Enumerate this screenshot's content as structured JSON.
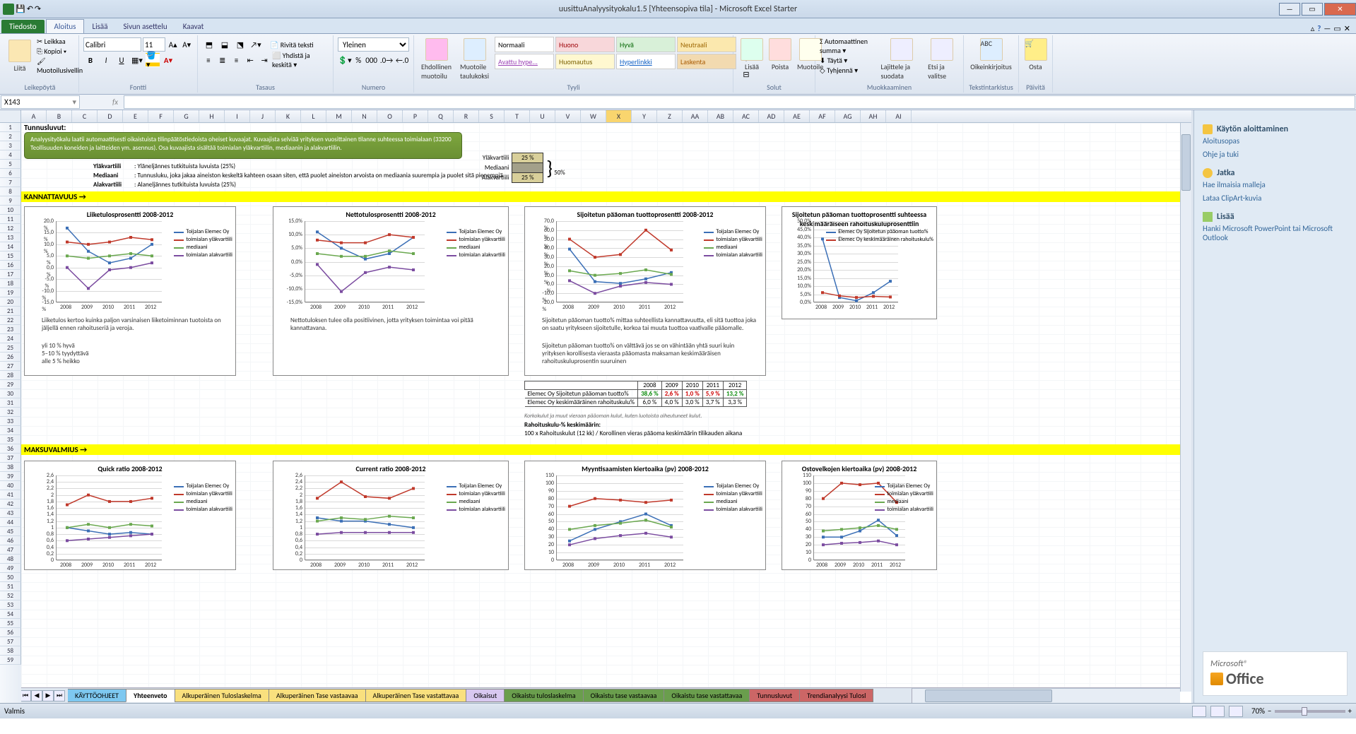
{
  "window": {
    "title": "uusittuAnalyysityokalu1.5 [Yhteensopiva tila] - Microsoft Excel Starter"
  },
  "tabs": {
    "file": "Tiedosto",
    "items": [
      "Aloitus",
      "Lisää",
      "Sivun asettelu",
      "Kaavat"
    ],
    "active": 0
  },
  "ribbon": {
    "clipboard": {
      "paste": "Liitä",
      "cut": "Leikkaa",
      "copy": "Kopioi",
      "format_painter": "Muotoilusivellin",
      "group": "Leikepöytä"
    },
    "font": {
      "family": "Calibri",
      "size": "11",
      "group": "Fontti"
    },
    "alignment": {
      "wrap": "Rivitä teksti",
      "merge": "Yhdistä ja keskitä",
      "group": "Tasaus"
    },
    "number": {
      "format": "Yleinen",
      "group": "Numero"
    },
    "styles": {
      "cond": "Ehdollinen muotoilu",
      "as_table": "Muotoile taulukoksi",
      "group": "Tyyli",
      "gallery": [
        {
          "label": "Normaali",
          "bg": "#ffffff",
          "fg": "#000"
        },
        {
          "label": "Huono",
          "bg": "#f8d7da",
          "fg": "#9c0006"
        },
        {
          "label": "Hyvä",
          "bg": "#d8f0d8",
          "fg": "#006400"
        },
        {
          "label": "Neutraali",
          "bg": "#fbe8ae",
          "fg": "#9c6500"
        },
        {
          "label": "Avattu hype...",
          "bg": "#ffffff",
          "fg": "#9b43b6"
        },
        {
          "label": "Huomautus",
          "bg": "#fff8d0",
          "fg": "#7a6000"
        },
        {
          "label": "Hyperlinkki",
          "bg": "#ffffff",
          "fg": "#1463c6"
        },
        {
          "label": "Laskenta",
          "bg": "#f2dab0",
          "fg": "#a95a00"
        }
      ]
    },
    "cells": {
      "insert": "Lisää",
      "delete": "Poista",
      "format": "Muotoile",
      "group": "Solut"
    },
    "editing": {
      "autosum": "Automaattinen summa",
      "fill": "Täytä",
      "clear": "Tyhjennä",
      "sort": "Lajittele ja suodata",
      "find": "Etsi ja valitse",
      "group": "Muokkaaminen"
    },
    "proofing": {
      "spell": "Oikeinkirjoitus",
      "group": "Tekstintarkistus"
    },
    "update": {
      "label": "Osta",
      "group": "Päivitä"
    }
  },
  "formula_bar": {
    "name_box": "X143",
    "formula": ""
  },
  "columns": [
    "A",
    "B",
    "C",
    "D",
    "E",
    "F",
    "G",
    "H",
    "I",
    "J",
    "K",
    "L",
    "M",
    "N",
    "O",
    "P",
    "Q",
    "R",
    "S",
    "T",
    "U",
    "V",
    "W",
    "X",
    "Y",
    "Z",
    "AA",
    "AB",
    "AC",
    "AD",
    "AE",
    "AF",
    "AG",
    "AH",
    "AI"
  ],
  "selected_col": "X",
  "task_pane": {
    "start_head": "Käytön aloittaminen",
    "start_links": [
      "Aloitusopas",
      "Ohje ja tuki"
    ],
    "continue_head": "Jatka",
    "continue_links": [
      "Hae ilmaisia malleja",
      "Lataa ClipArt-kuvia"
    ],
    "more_head": "Lisää",
    "more_links": [
      "Hanki Microsoft PowerPoint tai Microsoft Outlook"
    ],
    "brand_top": "Microsoft®",
    "brand_main": "Office"
  },
  "sheet": {
    "header": "Tunnusluvut:",
    "green_note": "Analyysityökalu laatii automaattisesti oikaistuista tilinpäätöstiedoista oheiset kuvaajat. Kuvaajista selviää yrityksen vuosittainen tilanne suhteessa toimialaan (33200 Teollisuuden koneiden ja laitteiden ym. asennus). Osa kuvaajista sisältää toimialan yläkvartiilin, mediaanin ja alakvartiilin.",
    "defs": [
      {
        "term": "Yläkvartiili",
        "text": ": Yläneljännes tutkituista luvuista (25%)"
      },
      {
        "term": "Mediaani",
        "text": ": Tunnusluku, joka jakaa aineiston keskeltä kahteen osaan siten, että puolet aineiston arvoista on mediaania suurempia ja puolet sitä pienempiä"
      },
      {
        "term": "Alakvartiili",
        "text": ": Alaneljännes tutkituista luvuista (25%)"
      }
    ],
    "quartiles": {
      "upper": "Yläkvartiili",
      "upper_v": "25 %",
      "median": "Mediaani",
      "lower": "Alakvartiili",
      "lower_v": "25 %",
      "total": "50%"
    },
    "band1": "KANNATTAVUUS",
    "band2": "MAKSUVALMIUS"
  },
  "legend_std": [
    "Toijalan Elemec Oy",
    "toimialan yläkvartiili",
    "mediaani",
    "toimialan alakvartiili"
  ],
  "legend_ch4": [
    "Elemec Oy Sijoitetun pääoman tuotto%",
    "Elemec Oy keskimääräinen rahoituskulu%"
  ],
  "years": [
    "2008",
    "2009",
    "2010",
    "2011",
    "2012"
  ],
  "chart_data": [
    {
      "id": "ch1",
      "type": "line",
      "title": "Liiketulosprosentti 2008-2012",
      "x": [
        "2008",
        "2009",
        "2010",
        "2011",
        "2012"
      ],
      "ylim": [
        -15,
        20
      ],
      "yticks": [
        -15,
        -10,
        -5,
        0,
        5,
        10,
        15,
        20
      ],
      "yfmt": "{v},0 %",
      "series": [
        {
          "name": "Toijalan Elemec Oy",
          "color": "#3b6fb6",
          "values": [
            17,
            7,
            2,
            4,
            10
          ]
        },
        {
          "name": "toimialan yläkvartiili",
          "color": "#c0392b",
          "values": [
            11,
            10,
            11,
            13,
            12
          ]
        },
        {
          "name": "mediaani",
          "color": "#6aa84f",
          "values": [
            5,
            4,
            5,
            6,
            5
          ]
        },
        {
          "name": "toimialan alakvartiili",
          "color": "#7b4ca0",
          "values": [
            0,
            -9,
            -1,
            0,
            2
          ]
        }
      ],
      "desc": "Liiketulos kertoo kuinka paljon varsinaisen liiketoiminnan tuotoista on jäljellä ennen rahoituseriä ja veroja.",
      "desc2": "yli 10 % hyvä\n5–10 % tyydyttävä\nalle 5 % heikko"
    },
    {
      "id": "ch2",
      "type": "line",
      "title": "Nettotulosprosentti 2008-2012",
      "x": [
        "2008",
        "2009",
        "2010",
        "2011",
        "2012"
      ],
      "ylim": [
        -15,
        15
      ],
      "yticks": [
        -15,
        -10,
        -5,
        0,
        5,
        10,
        15
      ],
      "yfmt": "{v},0%",
      "series": [
        {
          "name": "Toijalan Elemec Oy",
          "color": "#3b6fb6",
          "values": [
            11,
            5,
            1,
            3,
            9
          ]
        },
        {
          "name": "toimialan yläkvartiili",
          "color": "#c0392b",
          "values": [
            8,
            7,
            7,
            10,
            9
          ]
        },
        {
          "name": "mediaani",
          "color": "#6aa84f",
          "values": [
            3,
            2,
            2,
            4,
            3
          ]
        },
        {
          "name": "toimialan alakvartiili",
          "color": "#7b4ca0",
          "values": [
            -1,
            -11,
            -4,
            -2,
            -3
          ]
        }
      ],
      "desc": "Nettotuloksen tulee olla positiivinen, jotta yrityksen toimintaa voi pitää kannattavana."
    },
    {
      "id": "ch3",
      "type": "line",
      "title": "Sijoitetun pääoman tuottoprosentti 2008-2012",
      "x": [
        "2008",
        "2009",
        "2010",
        "2011",
        "2012"
      ],
      "ylim": [
        -20,
        70
      ],
      "yticks": [
        -20,
        -10,
        0,
        10,
        20,
        30,
        40,
        50,
        60,
        70
      ],
      "yfmt": "{v},0 %",
      "series": [
        {
          "name": "Toijalan Elemec Oy",
          "color": "#3b6fb6",
          "values": [
            39,
            3,
            1,
            6,
            13
          ]
        },
        {
          "name": "toimialan yläkvartiili",
          "color": "#c0392b",
          "values": [
            50,
            30,
            33,
            60,
            38
          ]
        },
        {
          "name": "mediaani",
          "color": "#6aa84f",
          "values": [
            15,
            10,
            12,
            16,
            11
          ]
        },
        {
          "name": "toimialan alakvartiili",
          "color": "#7b4ca0",
          "values": [
            4,
            -10,
            -2,
            2,
            0
          ]
        }
      ],
      "desc": "Sijoitetun pääoman tuotto% mittaa suhteellista kannattavuutta, eli sitä tuottoa joka on saatu yritykseen sijoitetulle, korkoa tai muuta tuottoa vaativalle pääomalle.",
      "desc2": "Sijoitetun pääoman tuotto% on välttävä jos se on vähintään yhtä suuri kuin yrityksen korollisesta vieraasta pääomasta maksaman keskimääräisen rahoituskuluprosentin suuruinen"
    },
    {
      "id": "ch4",
      "type": "line",
      "title": "Sijoitetun pääoman tuottoprosentti suhteessa keskimääräiseen rahoituskuluprosenttiin",
      "x": [
        "2008",
        "2009",
        "2010",
        "2011",
        "2012"
      ],
      "ylim": [
        0,
        50
      ],
      "yticks": [
        0,
        5,
        10,
        15,
        20,
        25,
        30,
        35,
        40,
        45,
        50
      ],
      "yfmt": "{v},0%",
      "series": [
        {
          "name": "Elemec Oy Sijoitetun pääoman tuotto%",
          "color": "#3b6fb6",
          "values": [
            39,
            3,
            1,
            6,
            13
          ]
        },
        {
          "name": "Elemec Oy keskimääräinen rahoituskulu%",
          "color": "#c0392b",
          "values": [
            6,
            4,
            3,
            3.7,
            3.3
          ]
        }
      ]
    },
    {
      "id": "ch5",
      "type": "line",
      "title": "Quick ratio 2008-2012",
      "x": [
        "2008",
        "2009",
        "2010",
        "2011",
        "2012"
      ],
      "ylim": [
        0,
        2.6
      ],
      "yticks": [
        0,
        0.2,
        0.4,
        0.6,
        0.8,
        1.0,
        1.2,
        1.4,
        1.6,
        1.8,
        2.0,
        2.2,
        2.4,
        2.6
      ],
      "yfmt": "{v}",
      "series": [
        {
          "name": "Toijalan Elemec Oy",
          "color": "#3b6fb6",
          "values": [
            1.0,
            0.9,
            0.8,
            0.85,
            0.8
          ]
        },
        {
          "name": "toimialan yläkvartiili",
          "color": "#c0392b",
          "values": [
            1.7,
            2.0,
            1.8,
            1.8,
            1.9
          ]
        },
        {
          "name": "mediaani",
          "color": "#6aa84f",
          "values": [
            1.0,
            1.1,
            1.0,
            1.1,
            1.05
          ]
        },
        {
          "name": "toimialan alakvartiili",
          "color": "#7b4ca0",
          "values": [
            0.6,
            0.65,
            0.7,
            0.75,
            0.8
          ]
        }
      ]
    },
    {
      "id": "ch6",
      "type": "line",
      "title": "Current ratio 2008-2012",
      "x": [
        "2008",
        "2009",
        "2010",
        "2011",
        "2012"
      ],
      "ylim": [
        0,
        2.6
      ],
      "yticks": [
        0,
        0.2,
        0.4,
        0.6,
        0.8,
        1.0,
        1.2,
        1.4,
        1.6,
        1.8,
        2.0,
        2.2,
        2.4,
        2.6
      ],
      "yfmt": "{v}",
      "series": [
        {
          "name": "Toijalan Elemec Oy",
          "color": "#3b6fb6",
          "values": [
            1.3,
            1.2,
            1.2,
            1.1,
            1.0
          ]
        },
        {
          "name": "toimialan yläkvartiili",
          "color": "#c0392b",
          "values": [
            1.9,
            2.4,
            1.95,
            1.9,
            2.2
          ]
        },
        {
          "name": "mediaani",
          "color": "#6aa84f",
          "values": [
            1.2,
            1.3,
            1.25,
            1.35,
            1.3
          ]
        },
        {
          "name": "toimialan alakvartiili",
          "color": "#7b4ca0",
          "values": [
            0.8,
            0.85,
            0.85,
            0.85,
            0.85
          ]
        }
      ]
    },
    {
      "id": "ch7",
      "type": "line",
      "title": "Myyntisaamisten kiertoaika (pv) 2008-2012",
      "x": [
        "2008",
        "2009",
        "2010",
        "2011",
        "2012"
      ],
      "ylim": [
        0,
        110
      ],
      "yticks": [
        0,
        10,
        20,
        30,
        40,
        50,
        60,
        70,
        80,
        90,
        100,
        110
      ],
      "yfmt": "{v}",
      "series": [
        {
          "name": "Toijalan Elemec Oy",
          "color": "#3b6fb6",
          "values": [
            25,
            40,
            50,
            60,
            45
          ]
        },
        {
          "name": "toimialan yläkvartiili",
          "color": "#c0392b",
          "values": [
            70,
            80,
            78,
            75,
            78
          ]
        },
        {
          "name": "mediaani",
          "color": "#6aa84f",
          "values": [
            40,
            45,
            48,
            52,
            43
          ]
        },
        {
          "name": "toimialan alakvartiili",
          "color": "#7b4ca0",
          "values": [
            20,
            28,
            32,
            35,
            30
          ]
        }
      ]
    },
    {
      "id": "ch8",
      "type": "line",
      "title": "Ostovelkojen kiertoaika (pv) 2008-2012",
      "x": [
        "2008",
        "2009",
        "2010",
        "2011",
        "2012"
      ],
      "ylim": [
        0,
        110
      ],
      "yticks": [
        0,
        10,
        20,
        30,
        40,
        50,
        60,
        70,
        80,
        90,
        100,
        110
      ],
      "yfmt": "{v}",
      "series": [
        {
          "name": "Toijalan Elemec Oy",
          "color": "#3b6fb6",
          "values": [
            30,
            30,
            38,
            52,
            32
          ]
        },
        {
          "name": "toimialan yläkvartiili",
          "color": "#c0392b",
          "values": [
            80,
            100,
            98,
            100,
            75
          ]
        },
        {
          "name": "mediaani",
          "color": "#6aa84f",
          "values": [
            38,
            40,
            42,
            45,
            40
          ]
        },
        {
          "name": "toimialan alakvartiili",
          "color": "#7b4ca0",
          "values": [
            20,
            22,
            23,
            25,
            20
          ]
        }
      ]
    }
  ],
  "table_ch3": {
    "headers": [
      "",
      "2008",
      "2009",
      "2010",
      "2011",
      "2012"
    ],
    "rows": [
      {
        "label": "Elemec Oy Sijoitetun pääoman tuotto%",
        "values": [
          "38,6 %",
          "2,6 %",
          "1,0 %",
          "5,9 %",
          "13,2 %"
        ],
        "colors": [
          "green",
          "red",
          "red",
          "red",
          "green"
        ]
      },
      {
        "label": "Elemec Oy keskimääräinen rahoituskulu%",
        "values": [
          "6,0 %",
          "4,0 %",
          "3,0 %",
          "3,7 %",
          "3,3 %"
        ],
        "colors": [
          "",
          "",
          "",
          "",
          ""
        ]
      }
    ],
    "footnote": "Korkokulut ja muut vieraan pääoman kulut, kuten luotoista aiheutuneet kulut.",
    "rk_head": "Rahoituskulu-% keskimäärin:",
    "rk_formula": "100 x Rahoituskulut (12 kk) / Korollinen vieras pääoma keskimäärin tilikauden aikana"
  },
  "sheet_tabs": [
    {
      "label": "KÄYTTÖOHJEET",
      "color": "#7ec8f0"
    },
    {
      "label": "Yhteenveto",
      "color": "#ffffff",
      "active": true
    },
    {
      "label": "Alkuperäinen Tuloslaskelma",
      "color": "#f9e07e"
    },
    {
      "label": "Alkuperäinen Tase vastaavaa",
      "color": "#f9e07e"
    },
    {
      "label": "Alkuperäinen Tase vastattavaa",
      "color": "#f9e07e"
    },
    {
      "label": "Oikaisut",
      "color": "#d8c8f0"
    },
    {
      "label": "Oikaistu tuloslaskelma",
      "color": "#6a9e4d"
    },
    {
      "label": "Oikaistu tase vastaavaa",
      "color": "#6a9e4d"
    },
    {
      "label": "Oikaistu tase vastattavaa",
      "color": "#6a9e4d"
    },
    {
      "label": "Tunnusluvut",
      "color": "#c66"
    },
    {
      "label": "Trendianalyysi Tulosl",
      "color": "#c66"
    }
  ],
  "status": {
    "ready": "Valmis",
    "zoom": "70%"
  }
}
